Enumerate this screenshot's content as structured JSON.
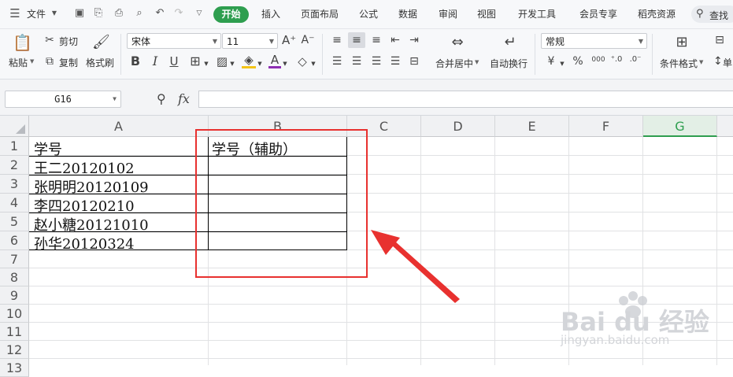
{
  "menu": {
    "file": "文件",
    "tabs": [
      "开始",
      "插入",
      "页面布局",
      "公式",
      "数据",
      "审阅",
      "视图",
      "开发工具",
      "会员专享",
      "稻壳资源"
    ],
    "search": "查找"
  },
  "ribbon": {
    "paste": "粘贴",
    "cut": "剪切",
    "copy": "复制",
    "format_painter": "格式刷",
    "font_name": "宋体",
    "font_size": "11",
    "bold": "B",
    "italic": "I",
    "underline": "U",
    "merge_center": "合并居中",
    "wrap_text": "自动换行",
    "number_format": "常规",
    "currency_symbol": "¥",
    "percent_symbol": "%",
    "thousands_symbol": "000",
    "conditional_format": "条件格式",
    "cut_off": "单"
  },
  "formula_bar": {
    "name_box": "G16",
    "fx": "fx",
    "value": ""
  },
  "sheet": {
    "columns": [
      "A",
      "B",
      "C",
      "D",
      "E",
      "F",
      "G"
    ],
    "selected_column": "G",
    "rows": [
      "1",
      "2",
      "3",
      "4",
      "5",
      "6",
      "7",
      "8",
      "9",
      "10",
      "11",
      "12",
      "13"
    ],
    "cells": {
      "A1": "学号",
      "B1": "学号（辅助）",
      "A2": "王二20120102",
      "A3": "张明明20120109",
      "A4": "李四20120210",
      "A5": "赵小糖20121010",
      "A6": "孙华20120324"
    }
  },
  "annotation": {
    "highlight_color": "#e8312f"
  },
  "watermark": {
    "brand": "Bai du 经验",
    "url": "jingyan.baidu.com"
  }
}
